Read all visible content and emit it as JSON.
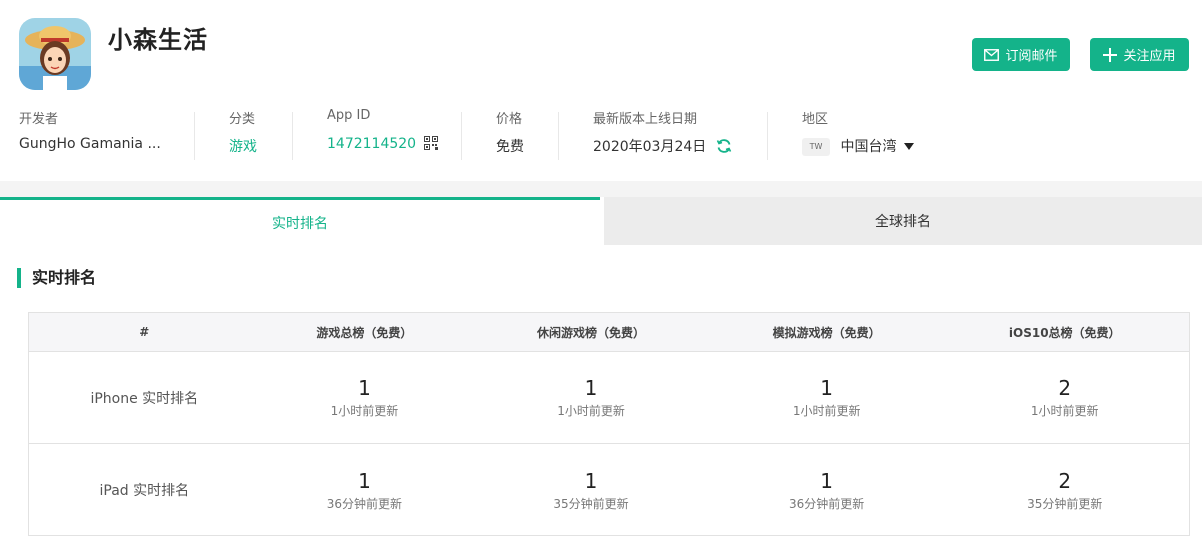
{
  "app": {
    "title": "小森生活"
  },
  "actions": {
    "subscribe_label": "订阅邮件",
    "follow_label": "关注应用"
  },
  "meta": {
    "developer_label": "开发者",
    "developer_value": "GungHo Gamania ...",
    "category_label": "分类",
    "category_value": "游戏",
    "appid_label": "App ID",
    "appid_value": "1472114520",
    "price_label": "价格",
    "price_value": "免费",
    "release_label": "最新版本上线日期",
    "release_value": "2020年03月24日",
    "region_label": "地区",
    "region_code": "TW",
    "region_value": "中国台湾"
  },
  "tabs": [
    {
      "label": "实时排名",
      "active": true
    },
    {
      "label": "全球排名",
      "active": false
    }
  ],
  "section_title": "实时排名",
  "table": {
    "headers": [
      "#",
      "游戏总榜（免费）",
      "休闲游戏榜（免费）",
      "模拟游戏榜（免费）",
      "iOS10总榜（免费）"
    ],
    "rows": [
      {
        "label": "iPhone 实时排名",
        "cells": [
          {
            "rank": "1",
            "updated": "1小时前更新"
          },
          {
            "rank": "1",
            "updated": "1小时前更新"
          },
          {
            "rank": "1",
            "updated": "1小时前更新"
          },
          {
            "rank": "2",
            "updated": "1小时前更新"
          }
        ]
      },
      {
        "label": "iPad 实时排名",
        "cells": [
          {
            "rank": "1",
            "updated": "36分钟前更新"
          },
          {
            "rank": "1",
            "updated": "35分钟前更新"
          },
          {
            "rank": "1",
            "updated": "36分钟前更新"
          },
          {
            "rank": "2",
            "updated": "35分钟前更新"
          }
        ]
      }
    ]
  },
  "colors": {
    "accent": "#14b38a"
  }
}
